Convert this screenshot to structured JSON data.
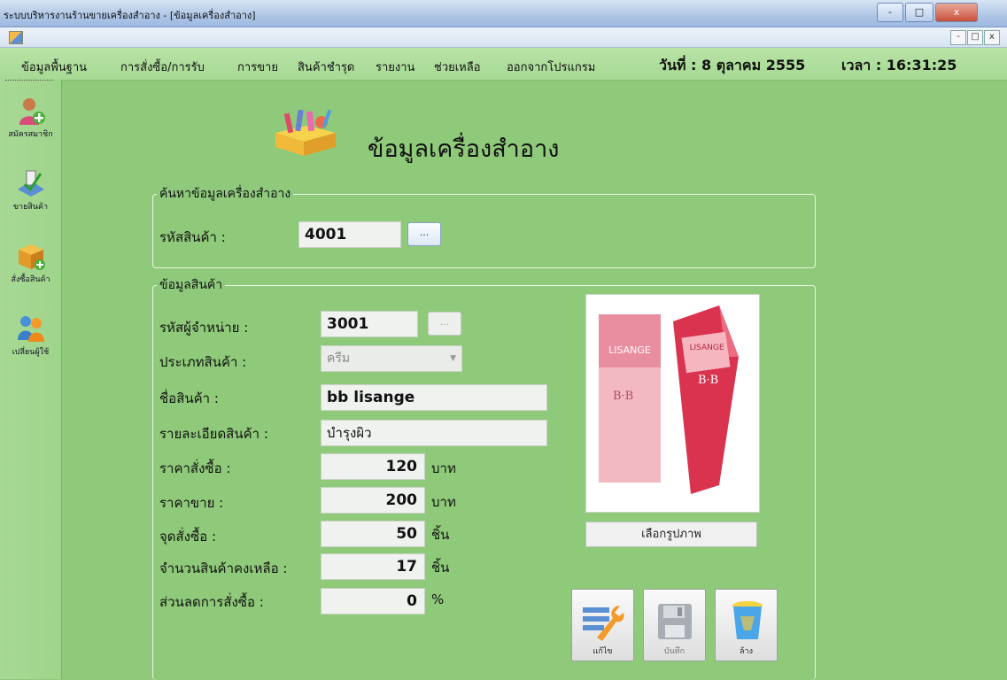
{
  "window": {
    "title": "ระบบบริหารงานร้านขายเครื่องสำอาง - [ข้อมูลเครื่องสำอาง]",
    "controls": [
      "-",
      "□",
      "x"
    ],
    "mdi_controls": [
      "-",
      "□",
      "x"
    ]
  },
  "menu": {
    "items": [
      "ข้อมูลพื้นฐาน",
      "การสั่งซื้อ/การรับ",
      "การขาย",
      "สินค้าชำรุด",
      "รายงาน",
      "ช่วยเหลือ",
      "ออกจากโปรแกรม"
    ],
    "date": "วันที่ : 8 ตุลาคม 2555",
    "time": "เวลา : 16:31:25"
  },
  "sidebar": {
    "items": [
      {
        "label": "สมัครสมาชิก",
        "icon": "add-member-icon"
      },
      {
        "label": "ขายสินค้า",
        "icon": "sell-icon"
      },
      {
        "label": "สั่งซื้อสินค้า",
        "icon": "order-box-icon"
      },
      {
        "label": "เปลี่ยนผู้ใช้",
        "icon": "switch-user-icon"
      }
    ]
  },
  "page": {
    "heading": "ข้อมูลเครื่องสำอาง"
  },
  "search": {
    "legend": "ค้นหาข้อมูลเครื่องสำอาง",
    "product_code_label": "รหัสสินค้า :",
    "product_code_value": "4001",
    "browse_label": "..."
  },
  "product": {
    "legend": "ข้อมูลสินค้า",
    "supplier_code_label": "รหัสผู้จำหน่าย :",
    "supplier_code_value": "3001",
    "supplier_browse_label": "...",
    "type_label": "ประเภทสินค้า :",
    "type_value": "ครีม",
    "name_label": "ชื่อสินค้า :",
    "name_value": "bb lisange",
    "detail_label": "รายละเอียดสินค้า :",
    "detail_value": "บำรุงผิว",
    "cost_label": "ราคาสั่งซื้อ :",
    "cost_value": "120",
    "cost_unit": "บาท",
    "price_label": "ราคาขาย :",
    "price_value": "200",
    "price_unit": "บาท",
    "reorder_label": "จุดสั่งซื้อ :",
    "reorder_value": "50",
    "reorder_unit": "ชิ้น",
    "stock_label": "จำนวนสินค้าคงเหลือ :",
    "stock_value": "17",
    "stock_unit": "ชิ้น",
    "discount_label": "ส่วนลดการสั่งซื้อ :",
    "discount_value": "0",
    "discount_unit": "%",
    "image_text": {
      "brand": "LISANGE",
      "bb": "B·B"
    },
    "select_image_label": "เลือกรูปภาพ"
  },
  "actions": {
    "edit": "แก้ไข",
    "save": "บันทึก",
    "delete": "ล้าง"
  }
}
